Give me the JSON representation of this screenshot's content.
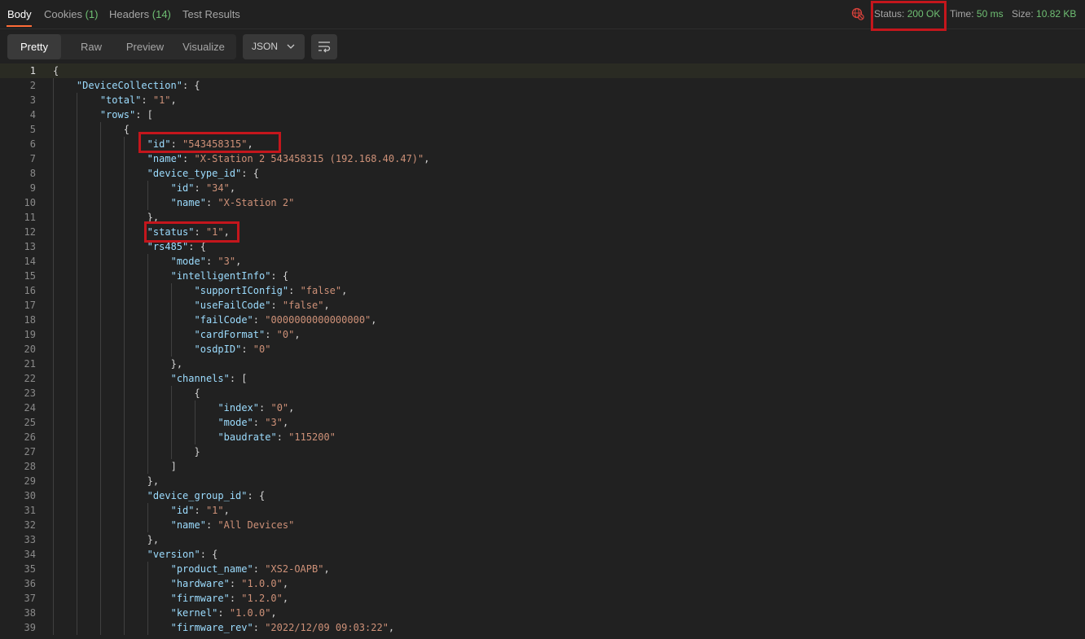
{
  "tabs": [
    {
      "label": "Body",
      "count": "",
      "active": true
    },
    {
      "label": "Cookies",
      "count": "(1)",
      "active": false
    },
    {
      "label": "Headers",
      "count": "(14)",
      "active": false
    },
    {
      "label": "Test Results",
      "count": "",
      "active": false
    }
  ],
  "response_meta": {
    "status_label": "Status:",
    "status_value": "200 OK",
    "time_label": "Time:",
    "time_value": "50 ms",
    "size_label": "Size:",
    "size_value": "10.82 KB"
  },
  "view_modes": [
    "Pretty",
    "Raw",
    "Preview",
    "Visualize"
  ],
  "active_view": "Pretty",
  "format_select": "JSON",
  "icons": {
    "globe": "globe-error-icon",
    "wrap": "wrap-lines-icon",
    "chevron": "chevron-down-icon"
  },
  "colors": {
    "accent": "#ff6c37",
    "success": "#6fbf73",
    "highlight_box": "#c4161c"
  },
  "code_lines": [
    {
      "n": "1",
      "indent": 0,
      "tokens": [
        [
          "p",
          "{"
        ]
      ]
    },
    {
      "n": "2",
      "indent": 1,
      "tokens": [
        [
          "k",
          "\"DeviceCollection\""
        ],
        [
          "p",
          ": {"
        ]
      ]
    },
    {
      "n": "3",
      "indent": 2,
      "tokens": [
        [
          "k",
          "\"total\""
        ],
        [
          "p",
          ": "
        ],
        [
          "s",
          "\"1\""
        ],
        [
          "p",
          ","
        ]
      ]
    },
    {
      "n": "4",
      "indent": 2,
      "tokens": [
        [
          "k",
          "\"rows\""
        ],
        [
          "p",
          ": ["
        ]
      ]
    },
    {
      "n": "5",
      "indent": 3,
      "tokens": [
        [
          "p",
          "{"
        ]
      ]
    },
    {
      "n": "6",
      "indent": 4,
      "tokens": [
        [
          "k",
          "\"id\""
        ],
        [
          "p",
          ": "
        ],
        [
          "s",
          "\"543458315\""
        ],
        [
          "p",
          ","
        ]
      ]
    },
    {
      "n": "7",
      "indent": 4,
      "tokens": [
        [
          "k",
          "\"name\""
        ],
        [
          "p",
          ": "
        ],
        [
          "s",
          "\"X-Station 2 543458315 (192.168.40.47)\""
        ],
        [
          "p",
          ","
        ]
      ]
    },
    {
      "n": "8",
      "indent": 4,
      "tokens": [
        [
          "k",
          "\"device_type_id\""
        ],
        [
          "p",
          ": {"
        ]
      ]
    },
    {
      "n": "9",
      "indent": 5,
      "tokens": [
        [
          "k",
          "\"id\""
        ],
        [
          "p",
          ": "
        ],
        [
          "s",
          "\"34\""
        ],
        [
          "p",
          ","
        ]
      ]
    },
    {
      "n": "10",
      "indent": 5,
      "tokens": [
        [
          "k",
          "\"name\""
        ],
        [
          "p",
          ": "
        ],
        [
          "s",
          "\"X-Station 2\""
        ]
      ]
    },
    {
      "n": "11",
      "indent": 4,
      "tokens": [
        [
          "p",
          "},"
        ]
      ]
    },
    {
      "n": "12",
      "indent": 4,
      "tokens": [
        [
          "k",
          "\"status\""
        ],
        [
          "p",
          ": "
        ],
        [
          "s",
          "\"1\""
        ],
        [
          "p",
          ","
        ]
      ]
    },
    {
      "n": "13",
      "indent": 4,
      "tokens": [
        [
          "k",
          "\"rs485\""
        ],
        [
          "p",
          ": {"
        ]
      ]
    },
    {
      "n": "14",
      "indent": 5,
      "tokens": [
        [
          "k",
          "\"mode\""
        ],
        [
          "p",
          ": "
        ],
        [
          "s",
          "\"3\""
        ],
        [
          "p",
          ","
        ]
      ]
    },
    {
      "n": "15",
      "indent": 5,
      "tokens": [
        [
          "k",
          "\"intelligentInfo\""
        ],
        [
          "p",
          ": {"
        ]
      ]
    },
    {
      "n": "16",
      "indent": 6,
      "tokens": [
        [
          "k",
          "\"supportIConfig\""
        ],
        [
          "p",
          ": "
        ],
        [
          "s",
          "\"false\""
        ],
        [
          "p",
          ","
        ]
      ]
    },
    {
      "n": "17",
      "indent": 6,
      "tokens": [
        [
          "k",
          "\"useFailCode\""
        ],
        [
          "p",
          ": "
        ],
        [
          "s",
          "\"false\""
        ],
        [
          "p",
          ","
        ]
      ]
    },
    {
      "n": "18",
      "indent": 6,
      "tokens": [
        [
          "k",
          "\"failCode\""
        ],
        [
          "p",
          ": "
        ],
        [
          "s",
          "\"0000000000000000\""
        ],
        [
          "p",
          ","
        ]
      ]
    },
    {
      "n": "19",
      "indent": 6,
      "tokens": [
        [
          "k",
          "\"cardFormat\""
        ],
        [
          "p",
          ": "
        ],
        [
          "s",
          "\"0\""
        ],
        [
          "p",
          ","
        ]
      ]
    },
    {
      "n": "20",
      "indent": 6,
      "tokens": [
        [
          "k",
          "\"osdpID\""
        ],
        [
          "p",
          ": "
        ],
        [
          "s",
          "\"0\""
        ]
      ]
    },
    {
      "n": "21",
      "indent": 5,
      "tokens": [
        [
          "p",
          "},"
        ]
      ]
    },
    {
      "n": "22",
      "indent": 5,
      "tokens": [
        [
          "k",
          "\"channels\""
        ],
        [
          "p",
          ": ["
        ]
      ]
    },
    {
      "n": "23",
      "indent": 6,
      "tokens": [
        [
          "p",
          "{"
        ]
      ]
    },
    {
      "n": "24",
      "indent": 7,
      "tokens": [
        [
          "k",
          "\"index\""
        ],
        [
          "p",
          ": "
        ],
        [
          "s",
          "\"0\""
        ],
        [
          "p",
          ","
        ]
      ]
    },
    {
      "n": "25",
      "indent": 7,
      "tokens": [
        [
          "k",
          "\"mode\""
        ],
        [
          "p",
          ": "
        ],
        [
          "s",
          "\"3\""
        ],
        [
          "p",
          ","
        ]
      ]
    },
    {
      "n": "26",
      "indent": 7,
      "tokens": [
        [
          "k",
          "\"baudrate\""
        ],
        [
          "p",
          ": "
        ],
        [
          "s",
          "\"115200\""
        ]
      ]
    },
    {
      "n": "27",
      "indent": 6,
      "tokens": [
        [
          "p",
          "}"
        ]
      ]
    },
    {
      "n": "28",
      "indent": 5,
      "tokens": [
        [
          "p",
          "]"
        ]
      ]
    },
    {
      "n": "29",
      "indent": 4,
      "tokens": [
        [
          "p",
          "},"
        ]
      ]
    },
    {
      "n": "30",
      "indent": 4,
      "tokens": [
        [
          "k",
          "\"device_group_id\""
        ],
        [
          "p",
          ": {"
        ]
      ]
    },
    {
      "n": "31",
      "indent": 5,
      "tokens": [
        [
          "k",
          "\"id\""
        ],
        [
          "p",
          ": "
        ],
        [
          "s",
          "\"1\""
        ],
        [
          "p",
          ","
        ]
      ]
    },
    {
      "n": "32",
      "indent": 5,
      "tokens": [
        [
          "k",
          "\"name\""
        ],
        [
          "p",
          ": "
        ],
        [
          "s",
          "\"All Devices\""
        ]
      ]
    },
    {
      "n": "33",
      "indent": 4,
      "tokens": [
        [
          "p",
          "},"
        ]
      ]
    },
    {
      "n": "34",
      "indent": 4,
      "tokens": [
        [
          "k",
          "\"version\""
        ],
        [
          "p",
          ": {"
        ]
      ]
    },
    {
      "n": "35",
      "indent": 5,
      "tokens": [
        [
          "k",
          "\"product_name\""
        ],
        [
          "p",
          ": "
        ],
        [
          "s",
          "\"XS2-OAPB\""
        ],
        [
          "p",
          ","
        ]
      ]
    },
    {
      "n": "36",
      "indent": 5,
      "tokens": [
        [
          "k",
          "\"hardware\""
        ],
        [
          "p",
          ": "
        ],
        [
          "s",
          "\"1.0.0\""
        ],
        [
          "p",
          ","
        ]
      ]
    },
    {
      "n": "37",
      "indent": 5,
      "tokens": [
        [
          "k",
          "\"firmware\""
        ],
        [
          "p",
          ": "
        ],
        [
          "s",
          "\"1.2.0\""
        ],
        [
          "p",
          ","
        ]
      ]
    },
    {
      "n": "38",
      "indent": 5,
      "tokens": [
        [
          "k",
          "\"kernel\""
        ],
        [
          "p",
          ": "
        ],
        [
          "s",
          "\"1.0.0\""
        ],
        [
          "p",
          ","
        ]
      ]
    },
    {
      "n": "39",
      "indent": 5,
      "tokens": [
        [
          "k",
          "\"firmware_rev\""
        ],
        [
          "p",
          ": "
        ],
        [
          "s",
          "\"2022/12/09 09:03:22\""
        ],
        [
          "p",
          ","
        ]
      ]
    }
  ]
}
